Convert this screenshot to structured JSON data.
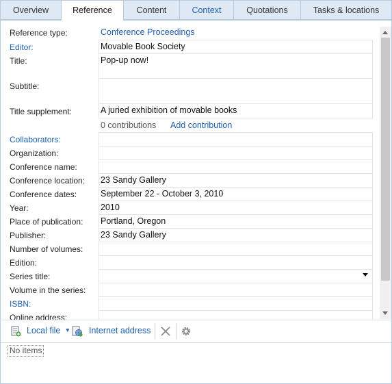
{
  "tabs": [
    {
      "label": "Overview"
    },
    {
      "label": "Reference"
    },
    {
      "label": "Content"
    },
    {
      "label": "Context"
    },
    {
      "label": "Quotations"
    },
    {
      "label": "Tasks & locations"
    }
  ],
  "form": {
    "reference_type_label": "Reference type:",
    "reference_type_value": "Conference Proceedings",
    "editor_label": "Editor:",
    "editor_value": "Movable Book Society",
    "title_label": "Title:",
    "title_value": "Pop-up now!",
    "subtitle_label": "Subtitle:",
    "subtitle_value": "",
    "title_supplement_label": "Title supplement:",
    "title_supplement_value": "A juried exhibition of movable books",
    "contributions_count": "0 contributions",
    "add_contribution": "Add contribution",
    "collaborators_label": "Collaborators:",
    "organization_label": "Organization:",
    "conference_name_label": "Conference name:",
    "conference_location_label": "Conference location:",
    "conference_location_value": "23 Sandy Gallery",
    "conference_dates_label": "Conference dates:",
    "conference_dates_value": "September 22 - October 3, 2010",
    "year_label": "Year:",
    "year_value": "2010",
    "place_label": "Place of publication:",
    "place_value": "Portland, Oregon",
    "publisher_label": "Publisher:",
    "publisher_value": "23 Sandy Gallery",
    "volumes_label": "Number of volumes:",
    "edition_label": "Edition:",
    "series_label": "Series title:",
    "volume_in_series_label": "Volume in the series:",
    "isbn_label": "ISBN:",
    "online_label": "Online address:"
  },
  "toolbar": {
    "local_file": "Local file",
    "internet_address": "Internet address"
  },
  "items": {
    "empty_text": "No items"
  },
  "colors": {
    "link": "#1f5fad",
    "tab_bg": "#dfe8f5",
    "border": "#b9c9de"
  }
}
